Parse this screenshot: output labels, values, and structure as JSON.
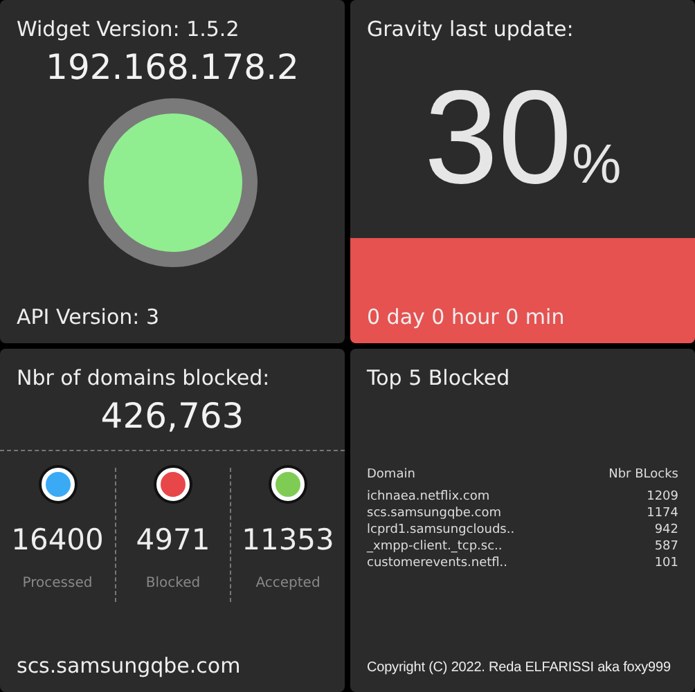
{
  "version_card": {
    "title": "Widget Version: 1.5.2",
    "ip": "192.168.178.2",
    "online": true,
    "api_version": "API Version: 3"
  },
  "gravity_card": {
    "title": "Gravity last update:",
    "percent": "30",
    "unit": "%",
    "level": 0.3,
    "elapsed": "0 day 0 hour 0 min"
  },
  "blocked_card": {
    "title": "Nbr of domains blocked:",
    "total": "426,763",
    "stats": [
      {
        "value": "16400",
        "label": "Processed",
        "color": "#3aaaf5"
      },
      {
        "value": "4971",
        "label": "Blocked",
        "color": "#e8474a"
      },
      {
        "value": "11353",
        "label": "Accepted",
        "color": "#7fcc55"
      }
    ],
    "last_domain": "scs.samsungqbe.com"
  },
  "top_card": {
    "title": "Top 5 Blocked",
    "columns": [
      "Domain",
      "Nbr BLocks"
    ],
    "rows": [
      [
        "ichnaea.netflix.com",
        "1209"
      ],
      [
        "scs.samsungqbe.com",
        "1174"
      ],
      [
        "lcprd1.samsungclouds..",
        "942"
      ],
      [
        "_xmpp-client._tcp.sc..",
        "587"
      ],
      [
        "customerevents.netfl..",
        "101"
      ]
    ],
    "footer": "Copyright (C) 2022.  Reda ELFARISSI aka foxy999"
  }
}
